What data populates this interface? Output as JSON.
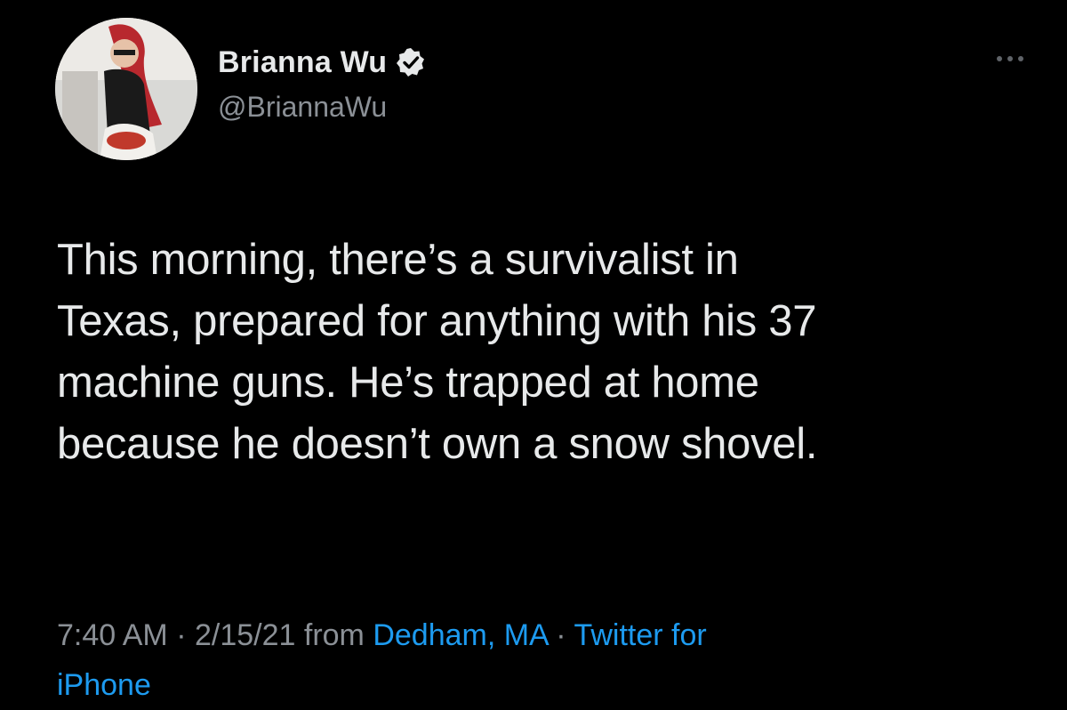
{
  "tweet": {
    "author": {
      "display_name": "Brianna Wu",
      "handle": "@BriannaWu",
      "verified": true,
      "avatar_icon": "profile-photo",
      "verified_icon": "verified-badge-icon"
    },
    "more_icon": "more-options-icon",
    "body_lines": [
      "This morning, there’s a survivalist in",
      "Texas, prepared for anything with his 37",
      "machine guns. He’s trapped at home",
      "because he doesn’t own a snow shovel."
    ],
    "meta": {
      "time": "7:40 AM",
      "separator": " · ",
      "date": "2/15/21",
      "from_text": " from ",
      "location": "Dedham, MA",
      "source_line1": "Twitter for",
      "source_line2": "iPhone"
    },
    "colors": {
      "background": "#000000",
      "text": "#e7e9ea",
      "secondary": "#8b9096",
      "link": "#1d9bf0"
    }
  }
}
